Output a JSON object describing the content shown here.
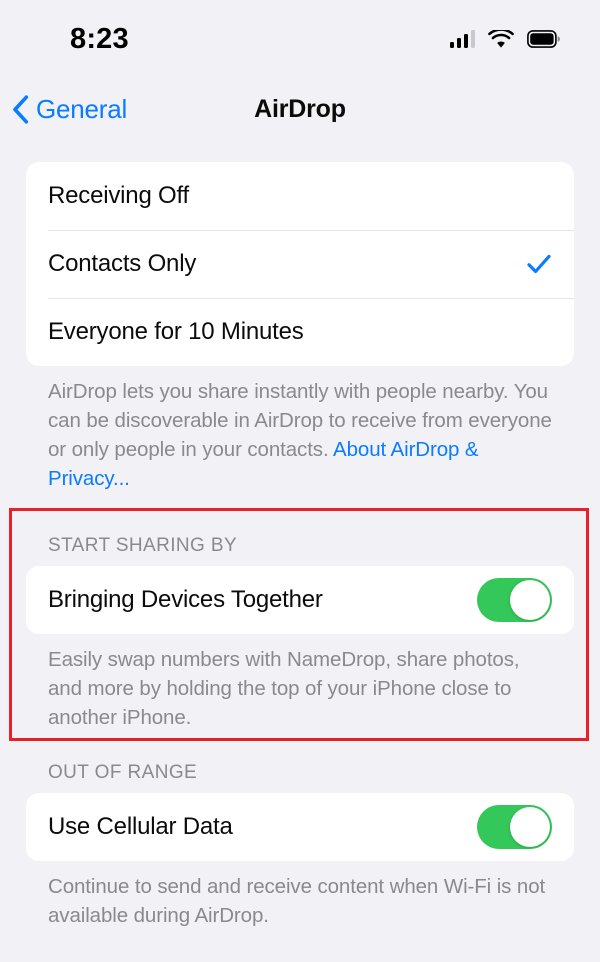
{
  "status_bar": {
    "time": "8:23",
    "cellular_icon": "cellular-signal-icon",
    "cellular_bars_filled": 3,
    "cellular_bars_total": 4,
    "wifi_icon": "wifi-icon",
    "battery_icon": "battery-full-icon"
  },
  "nav": {
    "back_icon": "chevron-left-icon",
    "back_label": "General",
    "title": "AirDrop"
  },
  "receiving": {
    "options": [
      {
        "label": "Receiving Off",
        "checked": false
      },
      {
        "label": "Contacts Only",
        "checked": true
      },
      {
        "label": "Everyone for 10 Minutes",
        "checked": false
      }
    ],
    "footer_text": "AirDrop lets you share instantly with people nearby. You can be discoverable in AirDrop to receive from everyone or only people in your contacts. ",
    "footer_link": "About AirDrop & Privacy..."
  },
  "start_sharing": {
    "header": "START SHARING BY",
    "row_label": "Bringing Devices Together",
    "toggle_state": "on",
    "footer_text": "Easily swap numbers with NameDrop, share photos, and more by holding the top of your iPhone close to another iPhone."
  },
  "out_of_range": {
    "header": "OUT OF RANGE",
    "row_label": "Use Cellular Data",
    "toggle_state": "on",
    "footer_text": "Continue to send and receive content when Wi-Fi is not available during AirDrop."
  },
  "colors": {
    "accent_blue": "#0a7cff",
    "toggle_green": "#34c759",
    "annotation_red": "#e8202a",
    "background": "#f1f1f6",
    "secondary_text": "#8a8a8e"
  }
}
